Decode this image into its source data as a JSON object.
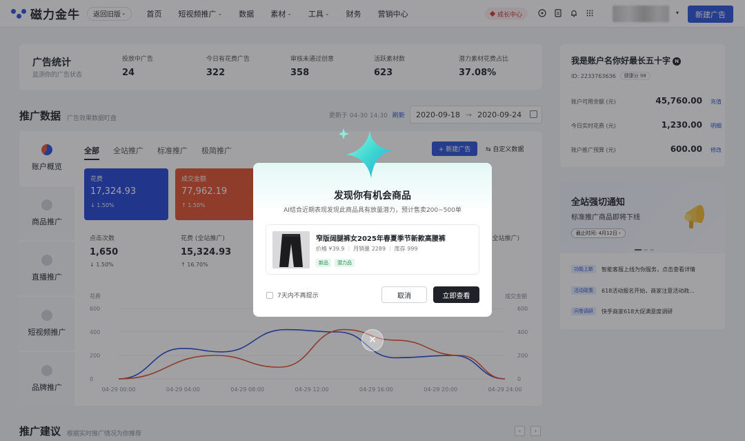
{
  "topnav": {
    "logo_text": "磁力金牛",
    "old_version": "返回旧版",
    "old_version_tiny": "▸",
    "items": [
      {
        "label": "首页",
        "chevron": false
      },
      {
        "label": "短视频推广",
        "chevron": true
      },
      {
        "label": "数据",
        "chevron": false
      },
      {
        "label": "素材",
        "chevron": true
      },
      {
        "label": "工具",
        "chevron": true
      },
      {
        "label": "财务",
        "chevron": false
      },
      {
        "label": "营销中心",
        "chevron": false
      }
    ],
    "growth_center": "成长中心",
    "new_ad": "新建广告"
  },
  "stats": {
    "title": "广告统计",
    "subtitle": "监测你的广告状态",
    "items": [
      {
        "label": "投放中广告",
        "value": "24"
      },
      {
        "label": "今日有花费广告",
        "value": "322"
      },
      {
        "label": "审核未通过创意",
        "value": "358"
      },
      {
        "label": "活跃素材数",
        "value": "623"
      },
      {
        "label": "潜力素材花费占比",
        "value": "37.08%"
      }
    ]
  },
  "promo": {
    "title": "推广数据",
    "subtitle": "广告效果数据盯盘",
    "update_label": "更新于 04-30 14:30",
    "refresh": "刷新",
    "date_start": "2020-09-18",
    "date_arrow": "→",
    "date_end": "2020-09-24",
    "side_tabs": [
      "账户概览",
      "商品推广",
      "直播推广",
      "短视频推广",
      "品牌推广"
    ],
    "ad_tabs": [
      "全部",
      "全站推广",
      "标准推广",
      "极简推广"
    ],
    "new_ad_small": "+ 新建广告",
    "custom_data": "⇆ 自定义数据",
    "metric_boxes": [
      {
        "label": "花费",
        "value": "17,324.93",
        "change": "↓ 1.50%",
        "color": "#2346d4"
      },
      {
        "label": "成交金额",
        "value": "77,962.19",
        "change": "↑ 1.50%",
        "color": "#e0512d"
      }
    ],
    "metrics_row2": [
      {
        "label": "点击次数",
        "value": "1,650",
        "change": "↓ 1.50%"
      },
      {
        "label": "花费 (全站推广)",
        "value": "15,324.93",
        "change": "↑ 16.70%"
      }
    ],
    "metric_partial": "(全站推广)",
    "chart_left_label": "花费",
    "chart_right_label": "成交金额"
  },
  "chart_data": {
    "type": "line",
    "x": [
      "04-29 00:00",
      "04-29 04:00",
      "04-29 08:00",
      "04-29 12:00",
      "04-29 16:00",
      "04-29 20:00",
      "04-29 24:00"
    ],
    "yticks": [
      0,
      200,
      400,
      600
    ],
    "y2ticks": [
      0,
      200,
      400,
      600
    ],
    "ylim": [
      0,
      600
    ],
    "series": [
      {
        "points": [
          [
            0,
            0
          ],
          [
            1,
            260
          ],
          [
            1.6,
            230
          ],
          [
            2.6,
            420
          ],
          [
            3.4,
            400
          ],
          [
            4.3,
            180
          ],
          [
            5.2,
            200
          ],
          [
            6,
            0
          ]
        ],
        "color": "#2346d4"
      },
      {
        "points": [
          [
            0,
            0
          ],
          [
            1.5,
            200
          ],
          [
            2.5,
            100
          ],
          [
            3.5,
            420
          ],
          [
            4.3,
            330
          ],
          [
            5.3,
            200
          ],
          [
            6,
            0
          ]
        ],
        "color": "#e0512d"
      }
    ]
  },
  "account": {
    "name": "我是账户名你好最长五十字",
    "badge": "N",
    "id_label": "ID: 2233763636",
    "health": "健康分 98",
    "rows": [
      {
        "label": "账户可用余额 (元)",
        "value": "45,760.00",
        "link": "充值"
      },
      {
        "label": "今日实时花费 (元)",
        "value": "1,230.00",
        "link": "明细"
      },
      {
        "label": "账户推广预算 (元)",
        "value": "600.00",
        "link": "修改"
      }
    ]
  },
  "notice": {
    "title": "全站强切通知",
    "subtitle": "标准推广商品即将下线",
    "deadline": "截止时间: 4月12日 ›",
    "items": [
      {
        "tag": "功能上新",
        "text": "智能客服上线为你服务，点击查看详情"
      },
      {
        "tag": "活动政策",
        "text": "618活动报名开始，商家注意活动政..."
      },
      {
        "tag": "问卷调研",
        "text": "快手商家618大促满意度调研"
      }
    ]
  },
  "recommend": {
    "title": "推广建议",
    "subtitle": "根据实时推广情况为你推荐"
  },
  "modal": {
    "title": "发现你有机会商品",
    "subtitle": "AI结合近期表现发现此商品具有放量潜力，预计售卖200~500单",
    "product_name": "窄版阔腿裤女2025年春夏季节新款高腰裤",
    "price": "价格 ¥39.9",
    "sales": "月销量 2289",
    "stock": "库存 999",
    "tags": [
      "新品",
      "潜力品"
    ],
    "dont_show": "7天内不再提示",
    "cancel": "取消",
    "view": "立即查看"
  }
}
